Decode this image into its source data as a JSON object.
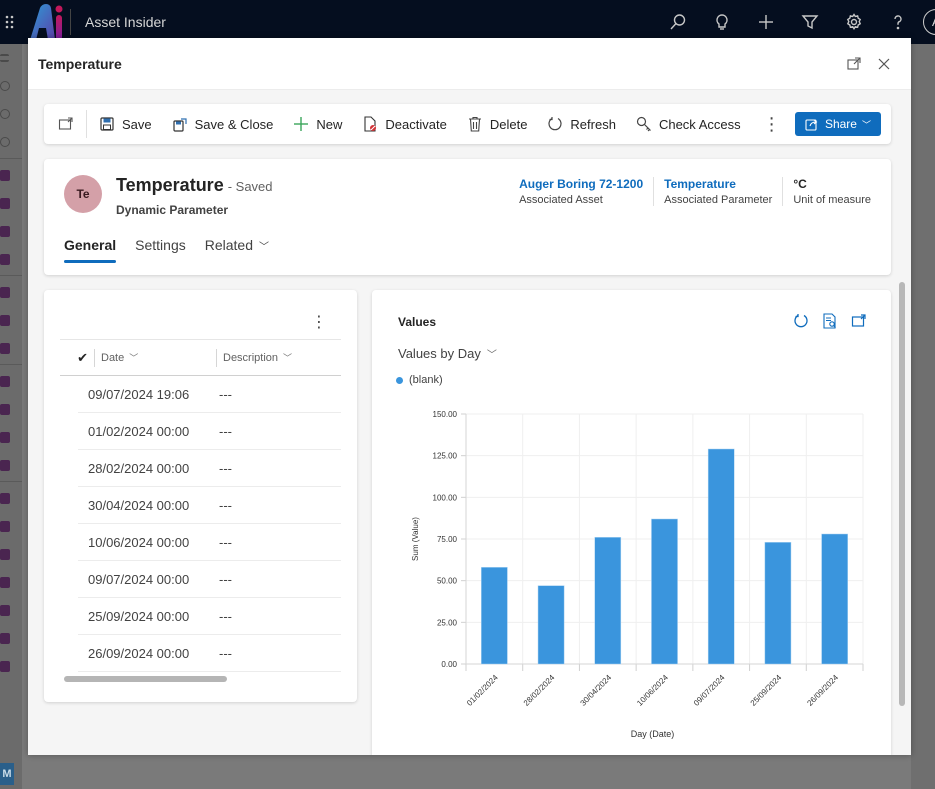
{
  "app": {
    "title": "Asset Insider",
    "user_initial": "A",
    "top_icons": [
      "search-icon",
      "lightbulb-icon",
      "plus-icon",
      "filter-icon",
      "settings-icon",
      "help-icon"
    ]
  },
  "dialog": {
    "title": "Temperature",
    "actions": [
      "expand-icon",
      "close-icon"
    ]
  },
  "command_bar": {
    "items": [
      {
        "label": "Save",
        "icon": "save-icon"
      },
      {
        "label": "Save & Close",
        "icon": "save-close-icon"
      },
      {
        "label": "New",
        "icon": "plus-icon"
      },
      {
        "label": "Deactivate",
        "icon": "deactivate-icon"
      },
      {
        "label": "Delete",
        "icon": "trash-icon"
      },
      {
        "label": "Refresh",
        "icon": "refresh-icon"
      },
      {
        "label": "Check Access",
        "icon": "key-icon"
      }
    ],
    "more": "⋮",
    "share_label": "Share",
    "share_color": "#0f6cbd"
  },
  "record": {
    "avatar_initials": "Te",
    "avatar_color": "#d4a0a8",
    "title": "Temperature",
    "status": "- Saved",
    "entity": "Dynamic Parameter",
    "fields": [
      {
        "value": "Auger Boring 72-1200",
        "label": "Associated Asset",
        "link": true
      },
      {
        "value": "Temperature",
        "label": "Associated Parameter",
        "link": true
      },
      {
        "value": "°C",
        "label": "Unit of measure",
        "link": false
      }
    ],
    "tabs": [
      {
        "label": "General",
        "active": true
      },
      {
        "label": "Settings",
        "active": false
      },
      {
        "label": "Related",
        "active": false,
        "dropdown": true
      }
    ]
  },
  "grid": {
    "more": "⋮",
    "check": "✔",
    "columns": [
      {
        "label": "Date"
      },
      {
        "label": "Description"
      }
    ],
    "rows": [
      {
        "date": "09/07/2024 19:06",
        "description": "---"
      },
      {
        "date": "01/02/2024 00:00",
        "description": "---"
      },
      {
        "date": "28/02/2024 00:00",
        "description": "---"
      },
      {
        "date": "30/04/2024 00:00",
        "description": "---"
      },
      {
        "date": "10/06/2024 00:00",
        "description": "---"
      },
      {
        "date": "09/07/2024 00:00",
        "description": "---"
      },
      {
        "date": "25/09/2024 00:00",
        "description": "---"
      },
      {
        "date": "26/09/2024 00:00",
        "description": "---"
      }
    ]
  },
  "chart_panel": {
    "title": "Values",
    "view_label": "Values by Day",
    "actions": [
      "refresh-icon",
      "view-records-icon",
      "expand-icon"
    ]
  },
  "chart_data": {
    "type": "bar",
    "title": "Values by Day",
    "xlabel": "Day (Date)",
    "ylabel": "Sum (Value)",
    "categories": [
      "01/02/2024",
      "28/02/2024",
      "30/04/2024",
      "10/06/2024",
      "09/07/2024",
      "25/09/2024",
      "26/09/2024"
    ],
    "series": [
      {
        "name": "(blank)",
        "color": "#3a95dd",
        "values": [
          58,
          47,
          76,
          87,
          129,
          73,
          78
        ]
      }
    ],
    "ylim": [
      0,
      150
    ],
    "yticks": [
      "0.00",
      "25.00",
      "50.00",
      "75.00",
      "100.00",
      "125.00",
      "150.00"
    ],
    "ytick_values": [
      0,
      25,
      50,
      75,
      100,
      125,
      150
    ],
    "grid": true,
    "legend": "top-left"
  }
}
